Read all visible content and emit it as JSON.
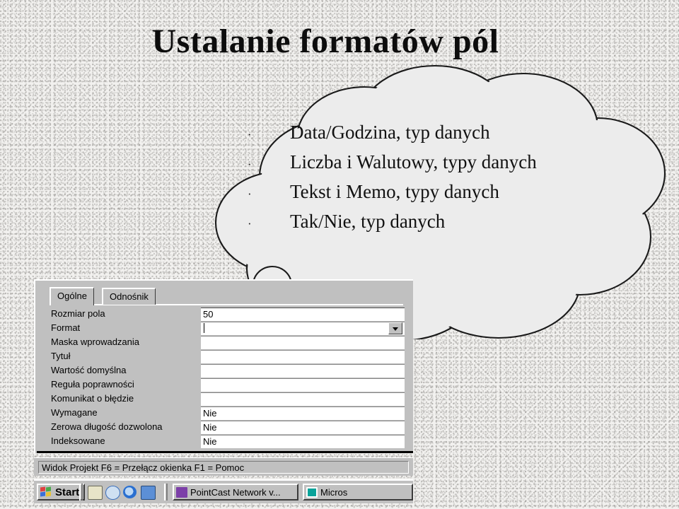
{
  "slide": {
    "title": "Ustalanie formatów pól",
    "background_color": "#f2f1ef"
  },
  "cloud": {
    "fill_color": "#ececec",
    "stroke_color": "#1a1a1a",
    "bullet_char": "·",
    "items": [
      "Data/Godzina, typ danych",
      "Liczba i Walutowy, typy danych",
      "Tekst i Memo, typy danych",
      "Tak/Nie, typ danych"
    ]
  },
  "screenshot": {
    "tabs": [
      {
        "label": "Ogólne",
        "selected": true
      },
      {
        "label": "Odnośnik",
        "selected": false
      }
    ],
    "properties": [
      {
        "label": "Rozmiar pola",
        "value": "50"
      },
      {
        "label": "Format",
        "value": "",
        "focused": true,
        "has_dropdown": true
      },
      {
        "label": "Maska wprowadzania",
        "value": ""
      },
      {
        "label": "Tytuł",
        "value": ""
      },
      {
        "label": "Wartość domyślna",
        "value": ""
      },
      {
        "label": "Reguła poprawności",
        "value": ""
      },
      {
        "label": "Komunikat o błędzie",
        "value": ""
      },
      {
        "label": "Wymagane",
        "value": "Nie"
      },
      {
        "label": "Zerowa długość dozwolona",
        "value": "Nie"
      },
      {
        "label": "Indeksowane",
        "value": "Nie"
      }
    ],
    "status_bar": "Widok Projekt  F6 = Przełącz okienka  F1 = Pomoc",
    "taskbar": {
      "start_label": "Start",
      "quick_launch": [
        {
          "name": "show-desktop-icon",
          "color": "#e8e4c8"
        },
        {
          "name": "channels-icon",
          "color": "#3a6fbc"
        },
        {
          "name": "internet-explorer-icon",
          "color": "#2a6fd0"
        },
        {
          "name": "network-icon",
          "color": "#5c8fd6"
        }
      ],
      "items": [
        {
          "label": "PointCast Network v...",
          "icon": "pointcast-icon",
          "icon_color": "#7c3fa8"
        },
        {
          "label": "Micros",
          "icon": "microsoft-access-icon",
          "icon_color": "#0aa39a"
        }
      ]
    },
    "chrome_color": "#c0c0c0"
  }
}
